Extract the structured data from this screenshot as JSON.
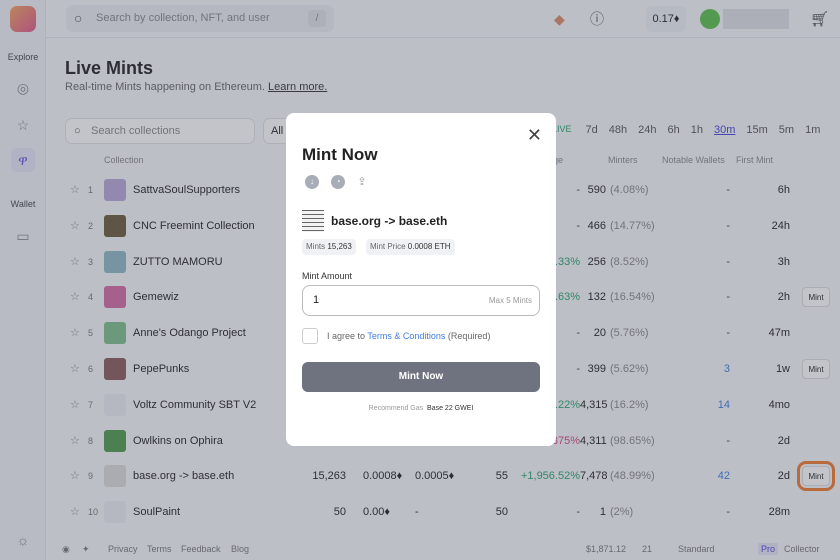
{
  "topbar": {
    "search_placeholder": "Search by collection, NFT, and user",
    "shortcut": "/",
    "balance": "0.17"
  },
  "sidebar": {
    "explore_label": "Explore",
    "wallet_label": "Wallet"
  },
  "page": {
    "title": "Live Mints",
    "subtitle": "Real-time Mints happening on Ethereum.",
    "learn_more": "Learn more.",
    "search_placeholder": "Search collections",
    "filter": "All",
    "live": "LIVE",
    "time_ranges": [
      "7d",
      "48h",
      "24h",
      "6h",
      "1h",
      "30m",
      "15m",
      "5m",
      "1m"
    ],
    "active_range": "30m"
  },
  "table": {
    "headers": {
      "collection": "Collection",
      "change": "nge",
      "minters": "Minters",
      "notable": "Notable Wallets",
      "first_mint": "First Mint"
    },
    "rows": [
      {
        "rank": "1",
        "name": "SattvaSoulSupporters",
        "thumb": "#b9a8d6",
        "change": "-",
        "minters": "590",
        "minters_pct": "(4.08%)",
        "notable": "-",
        "first": "6h",
        "mint": ""
      },
      {
        "rank": "2",
        "name": "CNC Freemint Collection",
        "thumb": "#6b5a3a",
        "change": "-",
        "minters": "466",
        "minters_pct": "(14.77%)",
        "notable": "-",
        "first": "24h",
        "mint": ""
      },
      {
        "rank": "3",
        "name": "ZUTTO MAMORU",
        "thumb": "#8fb8c4",
        "change": "3.33%",
        "minters": "256",
        "minters_pct": "(8.52%)",
        "notable": "-",
        "first": "3h",
        "mint": ""
      },
      {
        "rank": "4",
        "name": "Gemewiz",
        "thumb": "#d46aa3",
        "change": "588.63%",
        "minters": "132",
        "minters_pct": "(16.54%)",
        "notable": "-",
        "first": "2h",
        "mint": "Mint"
      },
      {
        "rank": "5",
        "name": "Anne's Odango Project",
        "thumb": "#7fbf8a",
        "change": "-",
        "minters": "20",
        "minters_pct": "(5.76%)",
        "notable": "-",
        "first": "47m",
        "mint": ""
      },
      {
        "rank": "6",
        "name": "PepePunks",
        "thumb": "#8a5a5a",
        "change": "-",
        "minters": "399",
        "minters_pct": "(5.62%)",
        "notable": "3",
        "first": "1w",
        "mint": "Mint"
      },
      {
        "rank": "7",
        "name": "Voltz Community SBT V2",
        "thumb": "#eceef2",
        "change": "1,222.22%",
        "minters": "4,315",
        "minters_pct": "(16.2%)",
        "notable": "14",
        "first": "4mo",
        "mint": ""
      },
      {
        "rank": "8",
        "name": "Owlkins on Ophira",
        "thumb": "#4f9a4a",
        "change": "375%",
        "minters": "4,311",
        "minters_pct": "(98.65%)",
        "notable": "-",
        "first": "2d",
        "mint": ""
      },
      {
        "rank": "9",
        "name": "base.org -> base.eth",
        "thumb": "#dcdcdc",
        "mints": "15,263",
        "price": "0.0008",
        "floor": "0.0005",
        "count": "55",
        "change": "+1,956.52%",
        "minters": "7,478",
        "minters_pct": "(48.99%)",
        "notable": "42",
        "first": "2d",
        "mint": "Mint"
      },
      {
        "rank": "10",
        "name": "SoulPaint",
        "thumb": "#eceef2",
        "mints": "50",
        "price": "0.00",
        "floor": "-",
        "count": "50",
        "change": "-",
        "minters": "1",
        "minters_pct": "(2%)",
        "notable": "-",
        "first": "28m",
        "mint": ""
      }
    ]
  },
  "footer": {
    "links": [
      "Privacy",
      "Terms",
      "Feedback",
      "Blog"
    ],
    "eth_price": "$1,871.12",
    "gas": "21",
    "gas_mode": "Standard",
    "mode_pro": "Pro",
    "mode_collector": "Collector"
  },
  "modal": {
    "title": "Mint Now",
    "collection": "base.org -> base.eth",
    "mints_label": "Mints",
    "mints": "15,263",
    "price_label": "Mint Price",
    "price": "0.0008 ETH",
    "amount_label": "Mint Amount",
    "amount": "1",
    "max": "Max 5 Mints",
    "agree": "I agree to",
    "terms": "Terms & Conditions",
    "required": "(Required)",
    "button": "Mint Now",
    "gas_label": "Recommend Gas",
    "gas": "Base 22 GWEI"
  },
  "colors": {
    "accent": "#4b44d8",
    "positive": "#2aa36b",
    "negative": "#d0457e",
    "highlight": "#f07a2b"
  }
}
